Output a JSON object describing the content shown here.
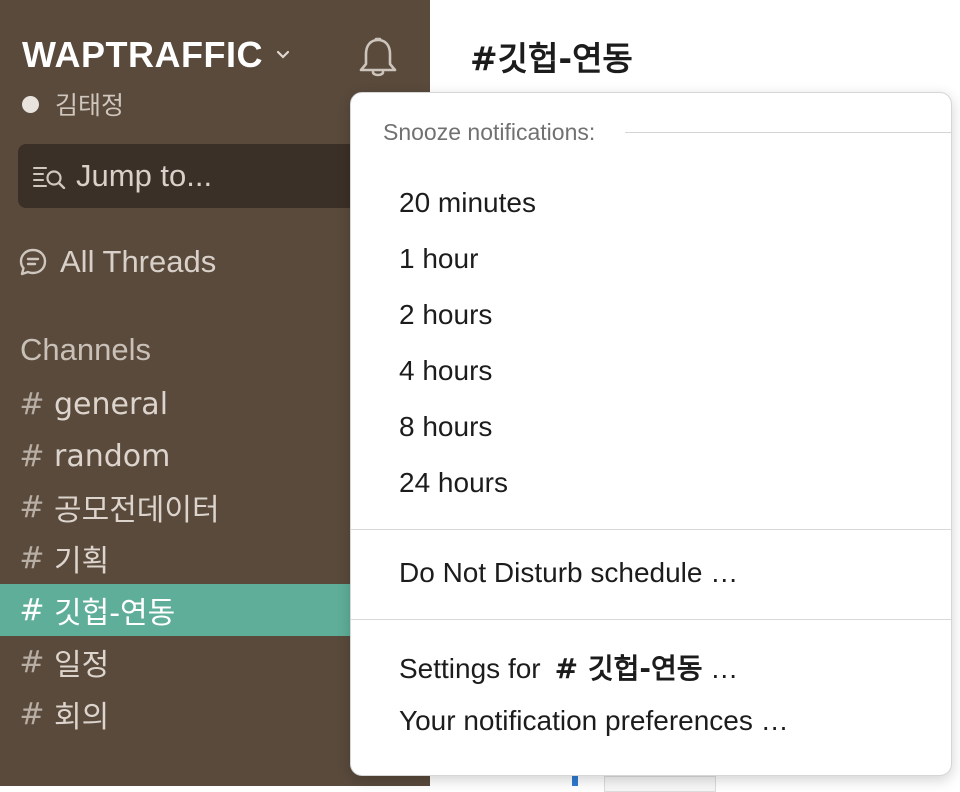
{
  "sidebar": {
    "team_name": "WAPTRAFFIC",
    "user_name": "김태정",
    "jump_placeholder": "Jump to...",
    "all_threads": "All Threads",
    "channels_header": "Channels",
    "channels": [
      {
        "name": "general",
        "active": false
      },
      {
        "name": "random",
        "active": false
      },
      {
        "name": "공모전데이터",
        "active": false
      },
      {
        "name": "기획",
        "active": false
      },
      {
        "name": "깃헙-연동",
        "active": true
      },
      {
        "name": "일정",
        "active": false
      },
      {
        "name": "회의",
        "active": false
      }
    ],
    "hash_symbol": "#"
  },
  "main": {
    "channel_title": "#깃헙-연동"
  },
  "snooze_menu": {
    "header": "Snooze notifications:",
    "options": [
      "20 minutes",
      "1 hour",
      "2 hours",
      "4 hours",
      "8 hours",
      "24 hours"
    ],
    "dnd_schedule": "Do Not Disturb schedule …",
    "settings_prefix": "Settings for",
    "settings_channel": "# 깃헙-연동",
    "settings_suffix": "…",
    "preferences": "Your notification preferences …"
  },
  "colors": {
    "sidebar_bg": "#594a3c",
    "active_channel": "#5fae9a",
    "link": "#1a73c7"
  }
}
